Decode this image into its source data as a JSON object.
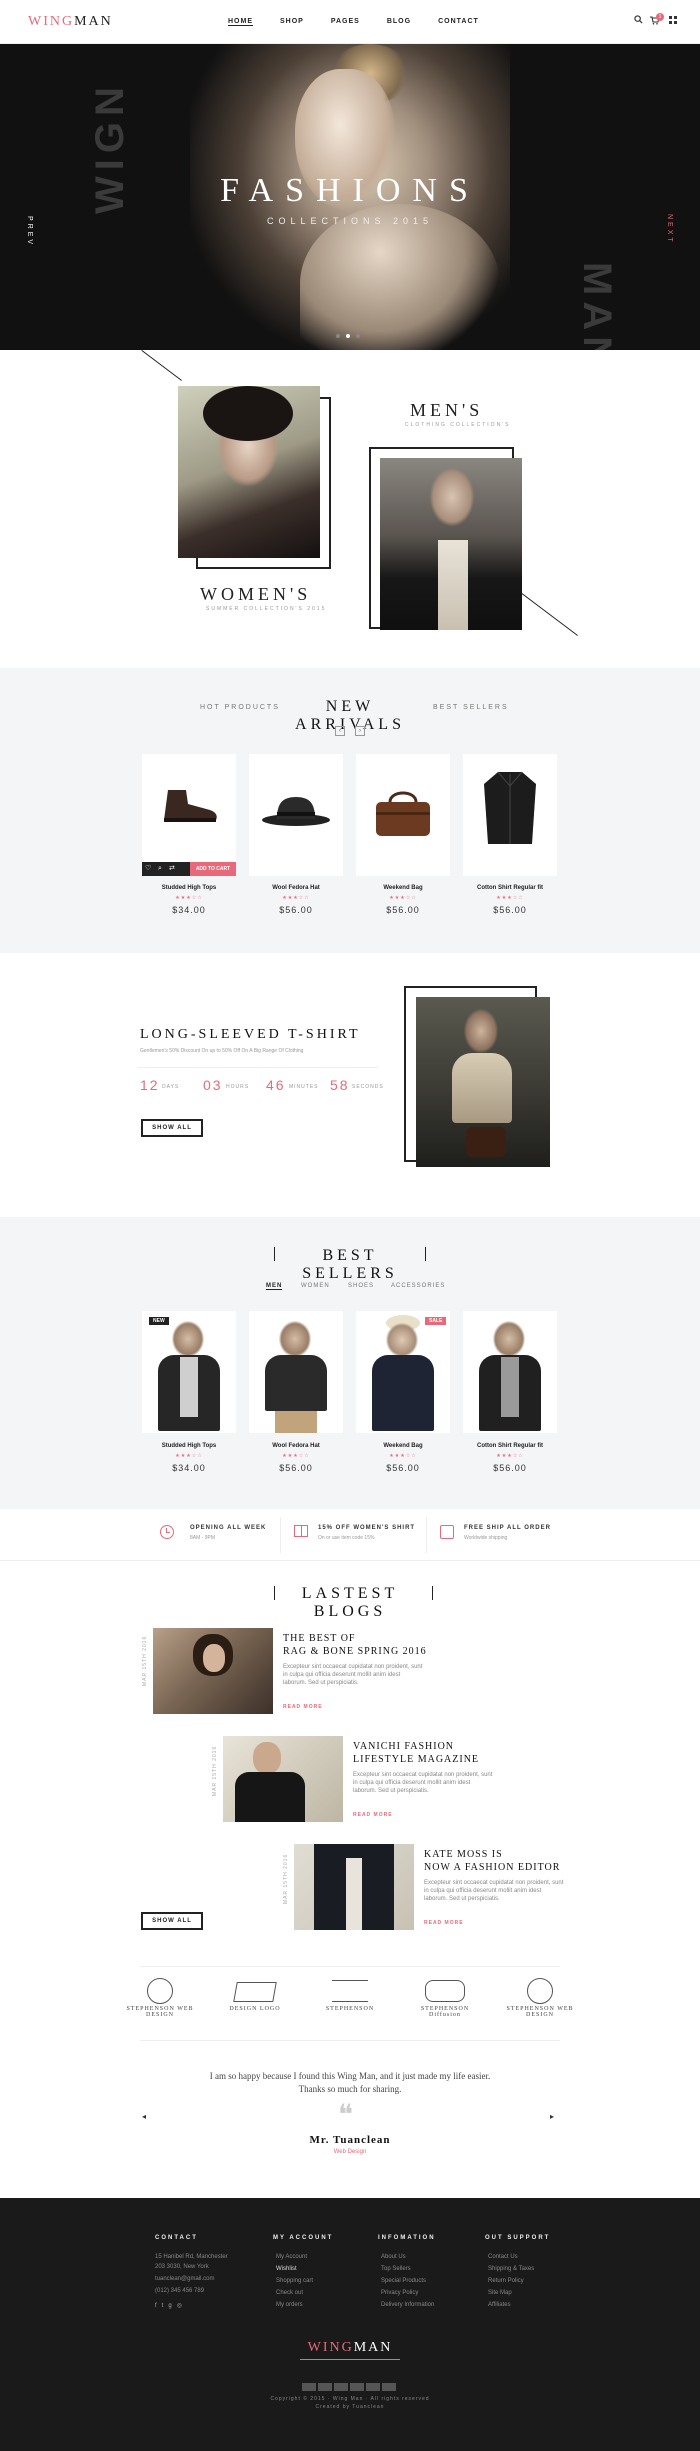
{
  "header": {
    "logo_a": "WING",
    "logo_b": "MAN",
    "nav": [
      "HOME",
      "SHOP",
      "PAGES",
      "BLOG",
      "CONTACT"
    ],
    "cart_count": "1",
    "icons": [
      "search-icon",
      "cart-icon",
      "menu-icon"
    ]
  },
  "hero": {
    "title": "FASHIONS",
    "subtitle": "COLLECTIONS 2015",
    "bg_left": "WIGN",
    "bg_right": "MAN",
    "prev": "PREV",
    "next": "NEXT",
    "slide_count": 3,
    "active_slide": 2
  },
  "collections": {
    "women_title": "WOMEN'S",
    "women_sub": "SUMMER COLLECTION'S 2015",
    "men_title": "MEN'S",
    "men_sub": "CLOTHING COLLECTION'S"
  },
  "arrivals": {
    "tab_left": "HOT PRODUCTS",
    "title": "NEW ARRIVALS",
    "tab_right": "BEST SELLERS",
    "add_to_cart": "ADD TO CART",
    "products": [
      {
        "name": "Studded High Tops",
        "price": "$34.00",
        "stars": "★★★☆☆"
      },
      {
        "name": "Wool Fedora Hat",
        "price": "$56.00",
        "stars": "★★★☆☆"
      },
      {
        "name": "Weekend Bag",
        "price": "$56.00",
        "stars": "★★★☆☆"
      },
      {
        "name": "Cotton Shirt Regular fit",
        "price": "$56.00",
        "stars": "★★★☆☆"
      }
    ]
  },
  "featured": {
    "title": "LONG-SLEEVED T-SHIRT",
    "desc": "Gentlemen's 50% Discount On up to 50% Off On A Big Range Of Clothing",
    "countdown": [
      {
        "num": "12",
        "label": "DAYS"
      },
      {
        "num": "03",
        "label": "HOURS"
      },
      {
        "num": "46",
        "label": "MINUTES"
      },
      {
        "num": "58",
        "label": "SECONDS"
      }
    ],
    "button": "SHOW ALL"
  },
  "bestsellers": {
    "title": "BEST SELLERS",
    "tabs": [
      "MEN",
      "WOMEN",
      "SHOES",
      "ACCESSORIES"
    ],
    "products": [
      {
        "name": "Studded High Tops",
        "price": "$34.00",
        "stars": "★★★☆☆",
        "badge": "NEW"
      },
      {
        "name": "Wool Fedora Hat",
        "price": "$56.00",
        "stars": "★★★☆☆",
        "badge": ""
      },
      {
        "name": "Weekend Bag",
        "price": "$56.00",
        "stars": "★★★☆☆",
        "badge": "SALE"
      },
      {
        "name": "Cotton Shirt Regular fit",
        "price": "$56.00",
        "stars": "★★★☆☆",
        "badge": ""
      }
    ]
  },
  "features": [
    {
      "title": "OPENING ALL WEEK",
      "sub": "8AM - 9PM",
      "icon": "clock-icon"
    },
    {
      "title": "15% OFF WOMEN'S SHIRT",
      "sub": "On or use item code 15%",
      "icon": "gift-icon"
    },
    {
      "title": "FREE SHIP ALL ORDER",
      "sub": "Worldwide shipping",
      "icon": "truck-icon"
    }
  ],
  "blogs": {
    "title": "LASTEST BLOGS",
    "read_more": "READ MORE",
    "button": "SHOW ALL",
    "date": "MAR 15TH 2016",
    "text": "Excepteur sint occaecat cupidatat non proident, sunt in culpa qui officia deserunt mollit anim idest laborum. Sed ut perspiciatis.",
    "posts": [
      {
        "title_1": "THE BEST OF",
        "title_2": "RAG & BONE SPRING 2016"
      },
      {
        "title_1": "VANICHI FASHION",
        "title_2": "LIFESTYLE MAGAZINE"
      },
      {
        "title_1": "KATE MOSS IS",
        "title_2": "NOW A FASHION EDITOR"
      }
    ]
  },
  "brands": [
    "STEPHENSON WEB DESIGN",
    "DESIGN LOGO",
    "STEPHENSON",
    "STEPHENSON Diffusion",
    "STEPHENSON WEB DESIGN"
  ],
  "testimonial": {
    "line1": "I am so happy because I found this Wing Man, and it just made my life easier.",
    "line2": "Thanks so much for sharing.",
    "name": "Mr. Tuanclean",
    "role": "Web Design"
  },
  "footer": {
    "contact_head": "CONTACT",
    "contact": [
      "15 Hanibel Rd, Manchester",
      "203 3030, New York",
      "tuanclean@gmail.com",
      "(012) 345 456 789"
    ],
    "account_head": "MY ACCOUNT",
    "account": [
      "My Account",
      "Wishlist",
      "Shopping cart",
      "Check out",
      "My orders"
    ],
    "info_head": "INFOMATION",
    "info": [
      "About Us",
      "Top Sellers",
      "Special Products",
      "Privacy Policy",
      "Delivery Information"
    ],
    "support_head": "OUT SUPPORT",
    "support": [
      "Contact Us",
      "Shipping & Taxes",
      "Return Policy",
      "Site Map",
      "Affiliates"
    ],
    "logo_a": "WING",
    "logo_b": "MAN",
    "copyright": "Copyright © 2015 · Wing Man · All rights reserved",
    "credit": "Created by Tuanclean",
    "social": [
      "facebook-icon",
      "twitter-icon",
      "google-plus-icon",
      "instagram-icon"
    ]
  },
  "colors": {
    "accent": "#e8697a",
    "dark": "#1a1a1a",
    "light_bg": "#f4f5f7"
  }
}
